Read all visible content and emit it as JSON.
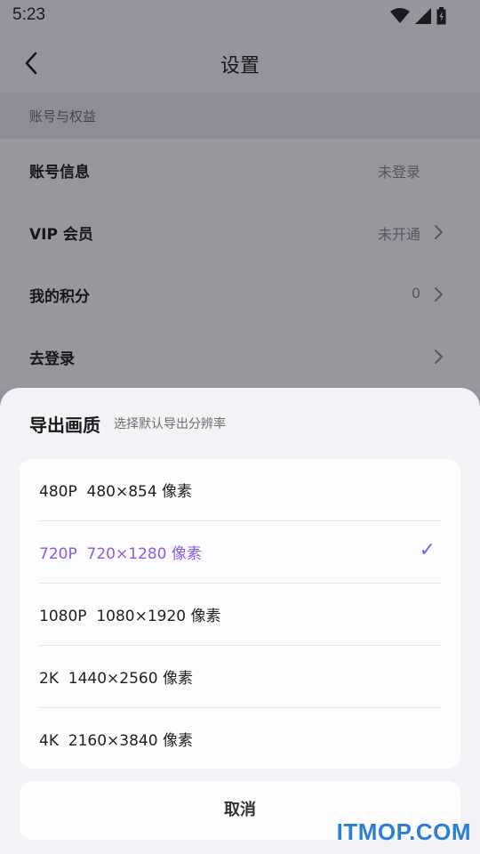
{
  "status_bar": {
    "time": "5:23"
  },
  "nav": {
    "title": "设置"
  },
  "section": {
    "title": "账号与权益"
  },
  "rows": [
    {
      "label": "账号信息",
      "value": "未登录"
    },
    {
      "label": "VIP 会员",
      "value": "未开通"
    },
    {
      "label": "我的积分",
      "value": "0"
    },
    {
      "label": "去登录",
      "value": ""
    }
  ],
  "sheet": {
    "title": "导出画质",
    "subtitle": "选择默认导出分辨率",
    "options": [
      {
        "label": "480P  480×854 像素",
        "selected": false
      },
      {
        "label": "720P  720×1280 像素",
        "selected": true
      },
      {
        "label": "1080P  1080×1920 像素",
        "selected": false
      },
      {
        "label": "2K  1440×2560 像素",
        "selected": false
      },
      {
        "label": "4K  2160×3840 像素",
        "selected": false
      }
    ],
    "check_glyph": "✓",
    "cancel_label": "取消"
  },
  "watermark": "ITMOP.COM",
  "colors": {
    "accent": "#8a5ce0",
    "watermark": "#2d7fd6"
  }
}
